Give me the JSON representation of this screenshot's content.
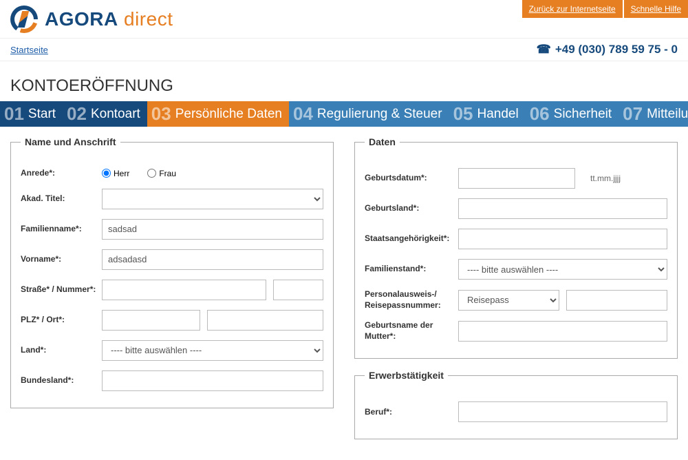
{
  "header": {
    "logo_main": "AGORA",
    "logo_sub": "direct",
    "link_back": "Zurück zur Internetseite",
    "link_help": "Schnelle Hilfe"
  },
  "subhead": {
    "home": "Startseite",
    "phone": "+49 (030) 789 59 75 - 0"
  },
  "title": "KONTOERÖFFNUNG",
  "steps": {
    "s1n": "01",
    "s1": "Start",
    "s2n": "02",
    "s2": "Kontoart",
    "s3n": "03",
    "s3": "Persönliche Daten",
    "s4n": "04",
    "s4": "Regulierung & Steuer",
    "s5n": "05",
    "s5": "Handel",
    "s6n": "06",
    "s6": "Sicherheit",
    "s7n": "07",
    "s7": "Mitteilung"
  },
  "fs": {
    "name_legend": "Name und Anschrift",
    "daten_legend": "Daten",
    "erwerb_legend": "Erwerbstätigkeit",
    "anrede": "Anrede*:",
    "herr": "Herr",
    "frau": "Frau",
    "titel": "Akad. Titel:",
    "famname": "Familienname*:",
    "famname_v": "sadsad",
    "vorname": "Vorname*:",
    "vorname_v": "adsadasd",
    "strasse": "Straße* / Nummer*:",
    "plz": "PLZ* / Ort*:",
    "land": "Land*:",
    "bitte": "---- bitte auswählen ----",
    "bundesland": "Bundesland*:",
    "gebdat": "Geburtsdatum*:",
    "gebdat_hint": "tt.mm.jjjj",
    "gebland": "Geburtsland*:",
    "staat": "Staatsangehörigkeit*:",
    "famstand": "Familienstand*:",
    "ausweis": "Personalausweis-/ Reisepassnummer:",
    "reisepass": "Reisepass",
    "gebname": "Geburtsname der Mutter*:",
    "beruf": "Beruf*:"
  }
}
